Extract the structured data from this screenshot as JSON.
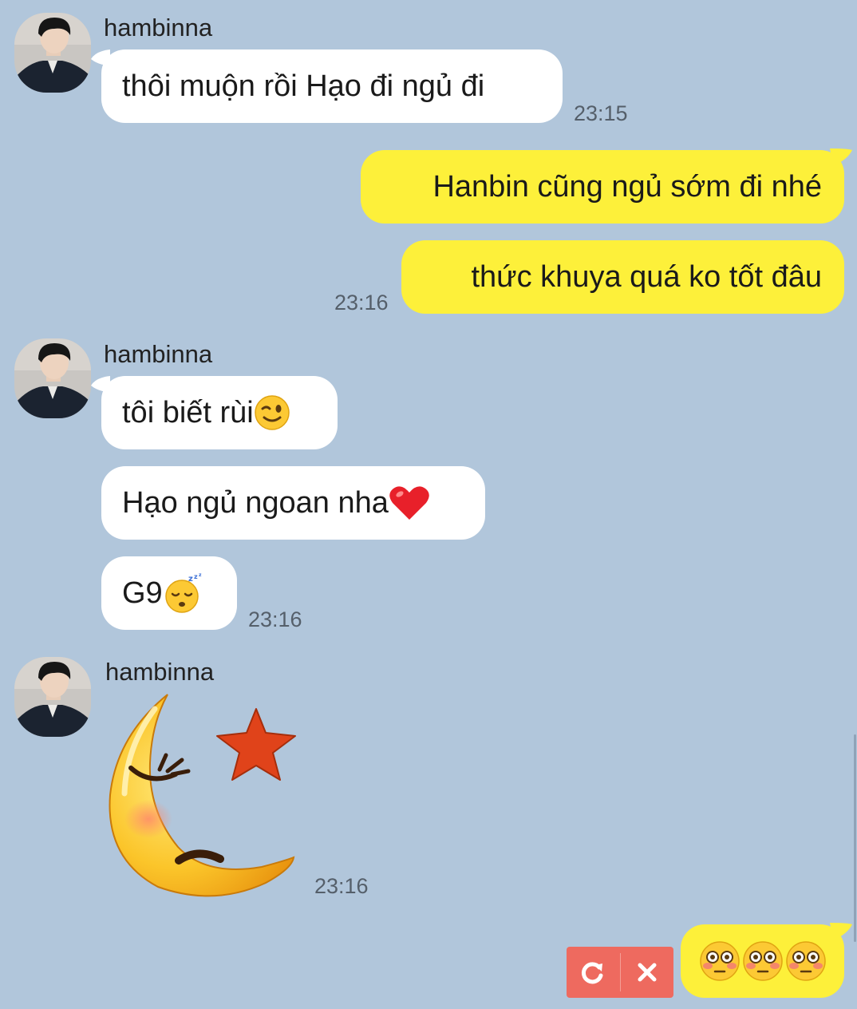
{
  "colors": {
    "background": "#b1c6db",
    "incoming_bubble": "#ffffff",
    "outgoing_bubble": "#fdf03a",
    "resend_box": "#ee6a5f"
  },
  "messages": [
    {
      "type": "incoming",
      "sender": "hambinna",
      "text": "thôi muộn rồi Hạo đi ngủ đi",
      "time": "23:15"
    },
    {
      "type": "outgoing",
      "text": "Hanbin cũng ngủ sớm đi nhé"
    },
    {
      "type": "outgoing",
      "text": "thức khuya quá ko tốt đâu",
      "time": "23:16"
    },
    {
      "type": "incoming",
      "sender": "hambinna",
      "text": "tôi biết rùi",
      "emoji": "wink-emoji"
    },
    {
      "type": "incoming",
      "text": "Hạo ngủ ngoan nha",
      "emoji": "heart-emoji"
    },
    {
      "type": "incoming",
      "text": "G9 ",
      "emoji": "sleeping-emoji",
      "time": "23:16"
    },
    {
      "type": "incoming-sticker",
      "sender": "hambinna",
      "sticker": "sleeping-moon-sticker",
      "time": "23:16"
    },
    {
      "type": "outgoing-failed",
      "emoji": [
        "flushed-emoji",
        "flushed-emoji",
        "flushed-emoji"
      ]
    }
  ],
  "failed_actions": {
    "retry_icon": "retry-icon",
    "delete_icon": "close-icon"
  }
}
